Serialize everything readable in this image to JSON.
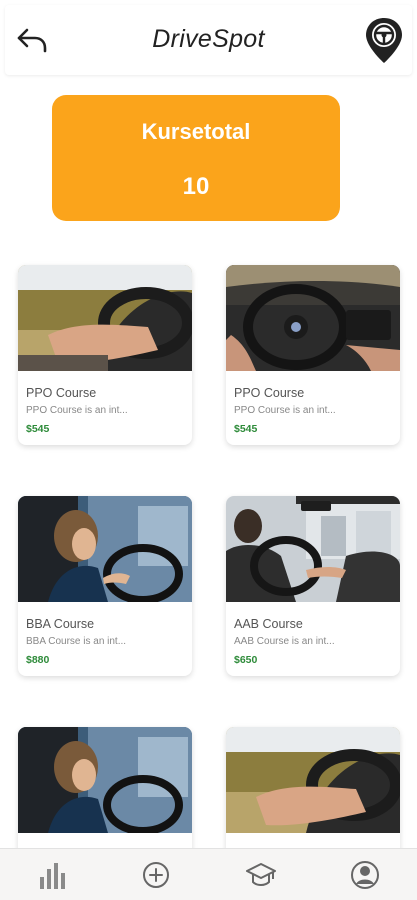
{
  "header": {
    "title": "DriveSpot"
  },
  "summary": {
    "label": "Kursetotal",
    "value": "10"
  },
  "courses": [
    {
      "name": "PPO Course",
      "description": "PPO Course is an int...",
      "price": "$545"
    },
    {
      "name": "PPO Course",
      "description": "PPO Course is an int...",
      "price": "$545"
    },
    {
      "name": "BBA Course",
      "description": "BBA Course is an int...",
      "price": "$880"
    },
    {
      "name": "AAB Course",
      "description": "AAB Course is an int...",
      "price": "$650"
    },
    {
      "name": "",
      "description": "",
      "price": ""
    },
    {
      "name": "",
      "description": "",
      "price": ""
    }
  ],
  "nav": {
    "items": [
      {
        "icon": "bar-chart-icon"
      },
      {
        "icon": "add-circle-icon"
      },
      {
        "icon": "graduation-cap-icon"
      },
      {
        "icon": "profile-icon"
      }
    ]
  },
  "colors": {
    "accent": "#fba41b",
    "price": "#2e8b3a",
    "nav_bg": "#f6f5f4"
  }
}
